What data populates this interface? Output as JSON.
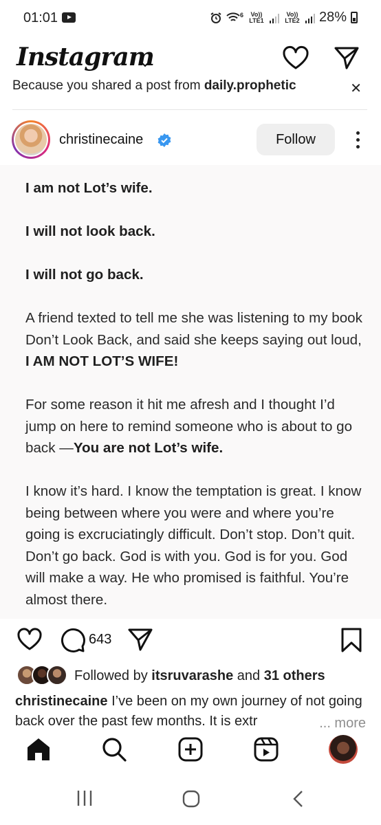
{
  "status_bar": {
    "time": "01:01",
    "wifi_label": "6",
    "lte1_label": "Vo)) LTE1",
    "lte2_label": "Vo)) LTE2",
    "battery": "28%"
  },
  "header": {
    "title": "Instagram",
    "icons": [
      "chevron-down-icon",
      "heart-icon",
      "send-icon"
    ]
  },
  "suggestion": {
    "text_prefix": "Because you shared a post from ",
    "account": "daily.prophetic"
  },
  "post": {
    "username": "christinecaine",
    "follow_label": "Follow",
    "paragraphs": [
      {
        "bold": "I am not Lot’s wife."
      },
      {
        "bold": "I will not look back."
      },
      {
        "bold": "I will not go back."
      },
      {
        "text": "A friend texted to tell me she was listening to my book Don’t Look Back, and said she keeps saying out loud, ",
        "bold": "I AM NOT LOT’S WIFE!"
      },
      {
        "text": "For some reason it hit me afresh and I thought I’d jump on here to remind someone who is about to go back —",
        "bold": "You are not Lot’s wife."
      },
      {
        "text": "I know it’s hard. I know the temptation is great. I know being between where you were and where you’re going is excruciatingly difficult. Don’t stop. Don’t quit. Don’t go back. God is with you. God is for you. God will make a way. He who promised is faithful. You’re almost there."
      }
    ],
    "comment_count": "643",
    "followed_by_prefix": "Followed by ",
    "followed_by_user": "itsruvarashe",
    "followed_by_and": " and ",
    "followed_by_others": "31 others",
    "caption_user": "christinecaine",
    "caption_text": " I’ve been on my own journey of not going back over the past few months. It is extr",
    "caption_more": "... more"
  },
  "colors": {
    "follow_bg": "#efefef",
    "verified": "#3897f0",
    "post_bg": "#faf9f9"
  }
}
